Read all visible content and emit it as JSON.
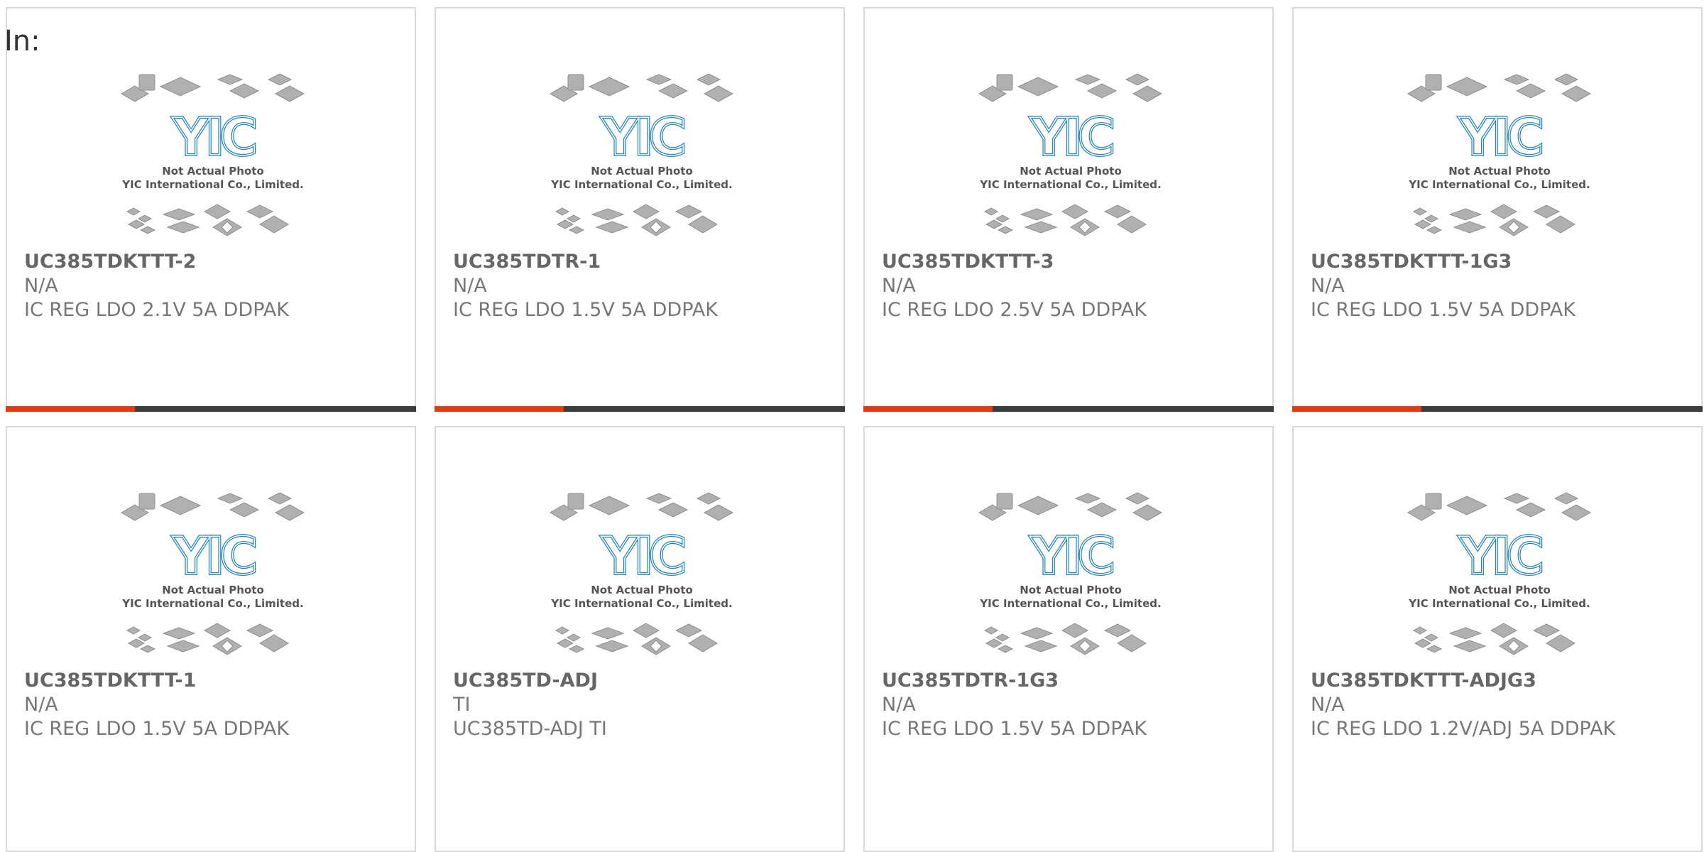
{
  "page": {
    "label": "In:"
  },
  "colors": {
    "bar_accent": "#e8380d",
    "bar_dark": "#3d3d3d",
    "logo_blue": "#1f86c6",
    "chip_gray": "#b0b0b0"
  },
  "placeholder": {
    "logo_text": "YIC",
    "line1": "Not Actual Photo",
    "line2": "YIC International Co., Limited."
  },
  "products": [
    {
      "part": "UC385TDKTTT-2",
      "manufacturer": "N/A",
      "description": "IC REG LDO 2.1V 5A DDPAK",
      "show_bar": true
    },
    {
      "part": "UC385TDTR-1",
      "manufacturer": "N/A",
      "description": "IC REG LDO 1.5V 5A DDPAK",
      "show_bar": true
    },
    {
      "part": "UC385TDKTTT-3",
      "manufacturer": "N/A",
      "description": "IC REG LDO 2.5V 5A DDPAK",
      "show_bar": true
    },
    {
      "part": "UC385TDKTTT-1G3",
      "manufacturer": "N/A",
      "description": "IC REG LDO 1.5V 5A DDPAK",
      "show_bar": true
    },
    {
      "part": "UC385TDKTTT-1",
      "manufacturer": "N/A",
      "description": "IC REG LDO 1.5V 5A DDPAK",
      "show_bar": false
    },
    {
      "part": "UC385TD-ADJ",
      "manufacturer": "TI",
      "description": "UC385TD-ADJ TI",
      "show_bar": false
    },
    {
      "part": "UC385TDTR-1G3",
      "manufacturer": "N/A",
      "description": "IC REG LDO 1.5V 5A DDPAK",
      "show_bar": false
    },
    {
      "part": "UC385TDKTTT-ADJG3",
      "manufacturer": "N/A",
      "description": "IC REG LDO 1.2V/ADJ 5A DDPAK",
      "show_bar": false
    }
  ]
}
